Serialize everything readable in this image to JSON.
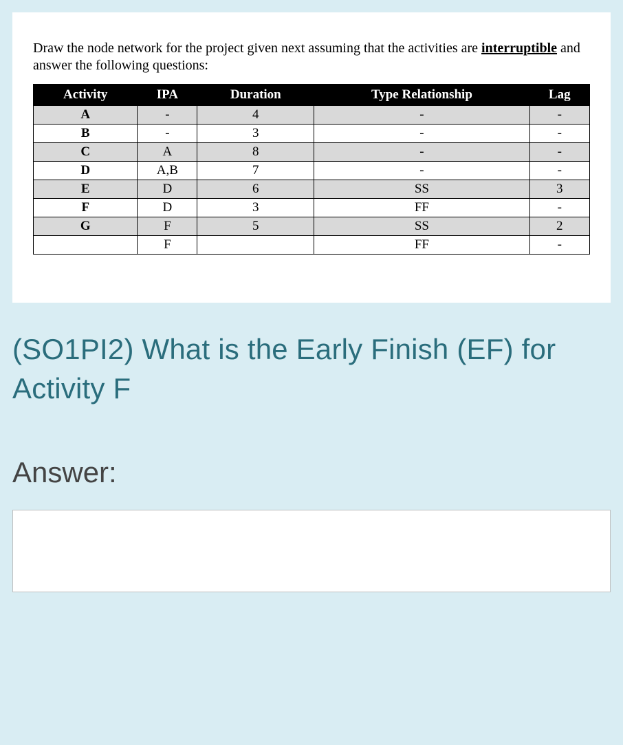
{
  "intro": {
    "pre": "Draw the node network for the project given next assuming that the activities are ",
    "key": "interruptible",
    "post": " and answer the following questions:"
  },
  "headers": [
    "Activity",
    "IPA",
    "Duration",
    "Type Relationship",
    "Lag"
  ],
  "rows": [
    {
      "shade": true,
      "cells": [
        "A",
        "-",
        "4",
        "-",
        "-"
      ]
    },
    {
      "shade": false,
      "cells": [
        "B",
        "-",
        "3",
        "-",
        "-"
      ]
    },
    {
      "shade": true,
      "cells": [
        "C",
        "A",
        "8",
        "-",
        "-"
      ]
    },
    {
      "shade": false,
      "cells": [
        "D",
        "A,B",
        "7",
        "-",
        "-"
      ]
    },
    {
      "shade": true,
      "cells": [
        "E",
        "D",
        "6",
        "SS",
        "3"
      ]
    },
    {
      "shade": false,
      "cells": [
        "F",
        "D",
        "3",
        "FF",
        "-"
      ]
    },
    {
      "shade": true,
      "cells": [
        "G",
        "F",
        "5",
        "SS",
        "2"
      ]
    },
    {
      "shade": false,
      "cells": [
        "",
        "F",
        "",
        "FF",
        "-"
      ]
    }
  ],
  "question": "(SO1PI2) What is the Early Finish (EF) for Activity F",
  "answerLabel": "Answer:",
  "answerValue": ""
}
